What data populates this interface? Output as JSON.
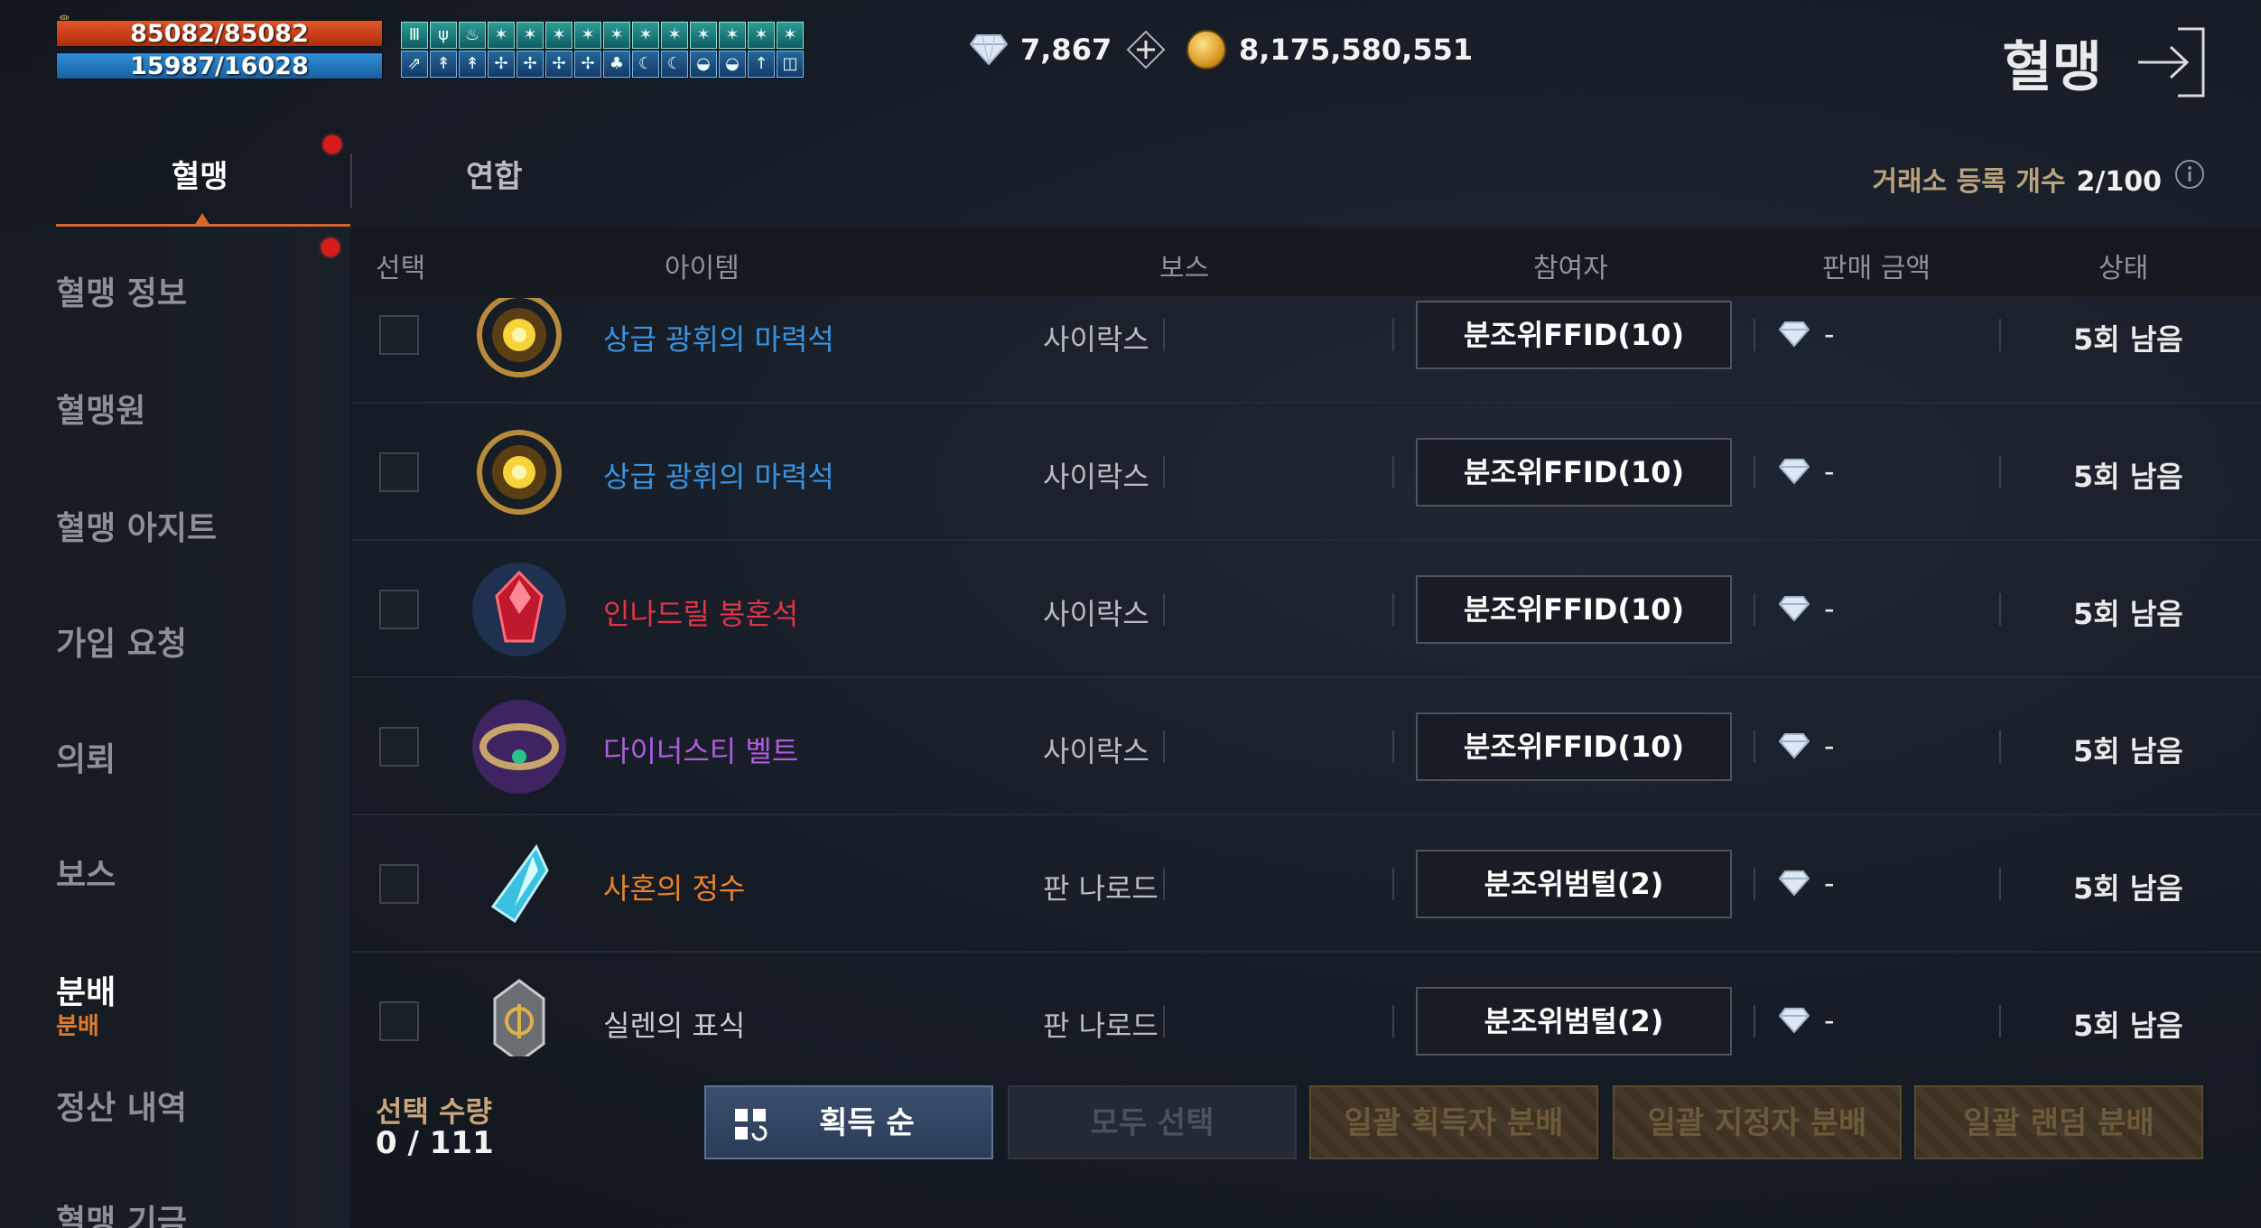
{
  "status_bars": {
    "hp": "85082/85082",
    "mp": "15987/16028"
  },
  "buff_icons": [
    "Ⅲ",
    "ψ",
    "♨",
    "✶",
    "✶",
    "✶",
    "✶",
    "✶",
    "✶",
    "✶",
    "✶",
    "✶",
    "✶",
    "✶",
    "⇗",
    "↟",
    "↟",
    "✢",
    "✢",
    "✢",
    "✢",
    "♣",
    "☾",
    "☾",
    "◒",
    "◒",
    "↑",
    "◫"
  ],
  "currency": {
    "diamonds": "7,867",
    "gold": "8,175,580,551"
  },
  "header": {
    "title": "혈맹"
  },
  "tabs": [
    {
      "label": "혈맹"
    },
    {
      "label": "연합"
    }
  ],
  "registration": {
    "label": "거래소 등록 개수",
    "value": "2/100"
  },
  "sidebar": {
    "items": [
      {
        "label": "혈맹 정보"
      },
      {
        "label": "혈맹원"
      },
      {
        "label": "혈맹 아지트"
      },
      {
        "label": "가입 요청"
      },
      {
        "label": "의뢰"
      },
      {
        "label": "보스"
      },
      {
        "label": "분배"
      },
      {
        "label": "정산 내역"
      },
      {
        "label": "혈맹 기금"
      }
    ],
    "active_sub": "분배"
  },
  "table": {
    "headers": {
      "select": "선택",
      "item": "아이템",
      "boss": "보스",
      "participant": "참여자",
      "price": "판매 금액",
      "status": "상태"
    },
    "rows": [
      {
        "item": "상급 광휘의 마력석",
        "color": "#3a93e0",
        "boss": "사이락스",
        "participant": "분조위FFID(10)",
        "price": "-",
        "status": "5회 남음"
      },
      {
        "item": "상급 광휘의 마력석",
        "color": "#3a93e0",
        "boss": "사이락스",
        "participant": "분조위FFID(10)",
        "price": "-",
        "status": "5회 남음"
      },
      {
        "item": "인나드릴 봉혼석",
        "color": "#e0344a",
        "boss": "사이락스",
        "participant": "분조위FFID(10)",
        "price": "-",
        "status": "5회 남음"
      },
      {
        "item": "다이너스티 벨트",
        "color": "#b05ce0",
        "boss": "사이락스",
        "participant": "분조위FFID(10)",
        "price": "-",
        "status": "5회 남음"
      },
      {
        "item": "사혼의 정수",
        "color": "#e8832a",
        "boss": "판 나로드",
        "participant": "분조위범털(2)",
        "price": "-",
        "status": "5회 남음"
      },
      {
        "item": "실렌의 표식",
        "color": "#c8ccd0",
        "boss": "판 나로드",
        "participant": "분조위범털(2)",
        "price": "-",
        "status": "5회 남음"
      }
    ]
  },
  "footer": {
    "selected_label": "선택 수량",
    "selected_value": "0 / 111",
    "sort_label": "획득 순",
    "select_all": "모두 선택",
    "bulk_acquirer": "일괄 획득자 분배",
    "bulk_designee": "일괄 지정자 분배",
    "bulk_random": "일괄 랜덤 분배"
  }
}
